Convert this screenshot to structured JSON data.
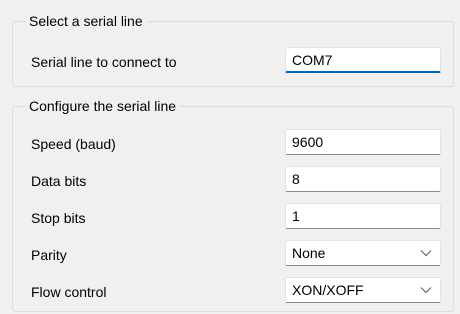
{
  "select_group": {
    "title": "Select a serial line",
    "rows": [
      {
        "label": "Serial line to connect to",
        "value": "COM7"
      }
    ]
  },
  "configure_group": {
    "title": "Configure the serial line",
    "rows": [
      {
        "label": "Speed (baud)",
        "value": "9600"
      },
      {
        "label": "Data bits",
        "value": "8"
      },
      {
        "label": "Stop bits",
        "value": "1"
      },
      {
        "label": "Parity",
        "value": "None"
      },
      {
        "label": "Flow control",
        "value": "XON/XOFF"
      }
    ]
  },
  "icons": {
    "dropdown": "chevron-down-icon"
  },
  "colors": {
    "background": "#f0f0f0",
    "focus_accent": "#0067c0",
    "field_background": "#ffffff"
  }
}
